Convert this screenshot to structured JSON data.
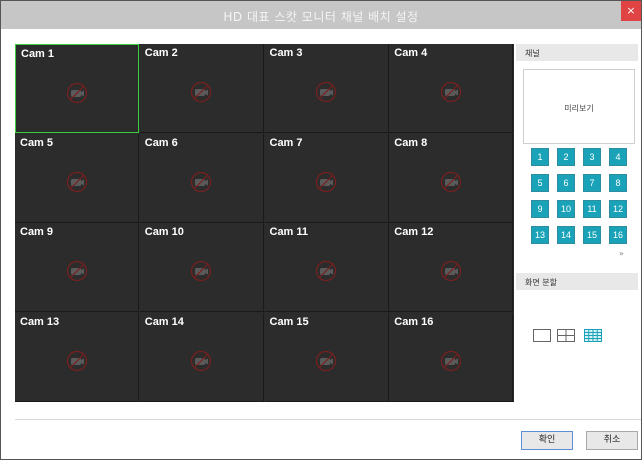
{
  "window": {
    "title": "HD 대표 스캇 모니터 채널 배치 설정",
    "close_glyph": "×"
  },
  "grid": {
    "cells": [
      {
        "label": "Cam 1"
      },
      {
        "label": "Cam 2"
      },
      {
        "label": "Cam 3"
      },
      {
        "label": "Cam 4"
      },
      {
        "label": "Cam 5"
      },
      {
        "label": "Cam 6"
      },
      {
        "label": "Cam 7"
      },
      {
        "label": "Cam 8"
      },
      {
        "label": "Cam 9"
      },
      {
        "label": "Cam 10"
      },
      {
        "label": "Cam 11"
      },
      {
        "label": "Cam 12"
      },
      {
        "label": "Cam 13"
      },
      {
        "label": "Cam 14"
      },
      {
        "label": "Cam 15"
      },
      {
        "label": "Cam 16"
      }
    ],
    "selected_index": 0
  },
  "panel": {
    "channel_header": "채널",
    "preview_label": "미리보기",
    "channels": [
      "1",
      "2",
      "3",
      "4",
      "5",
      "6",
      "7",
      "8",
      "9",
      "10",
      "11",
      "12",
      "13",
      "14",
      "15",
      "16"
    ],
    "more_glyph": "»",
    "split_header": "화면 분할",
    "layouts": [
      "single-layout-icon",
      "quad-layout-icon",
      "sixteen-layout-icon"
    ]
  },
  "footer": {
    "ok_label": "확인",
    "cancel_label": "취소"
  },
  "colors": {
    "accent": "#1aa3b8",
    "selected_border": "#3ccc3c",
    "close": "#e04343"
  }
}
